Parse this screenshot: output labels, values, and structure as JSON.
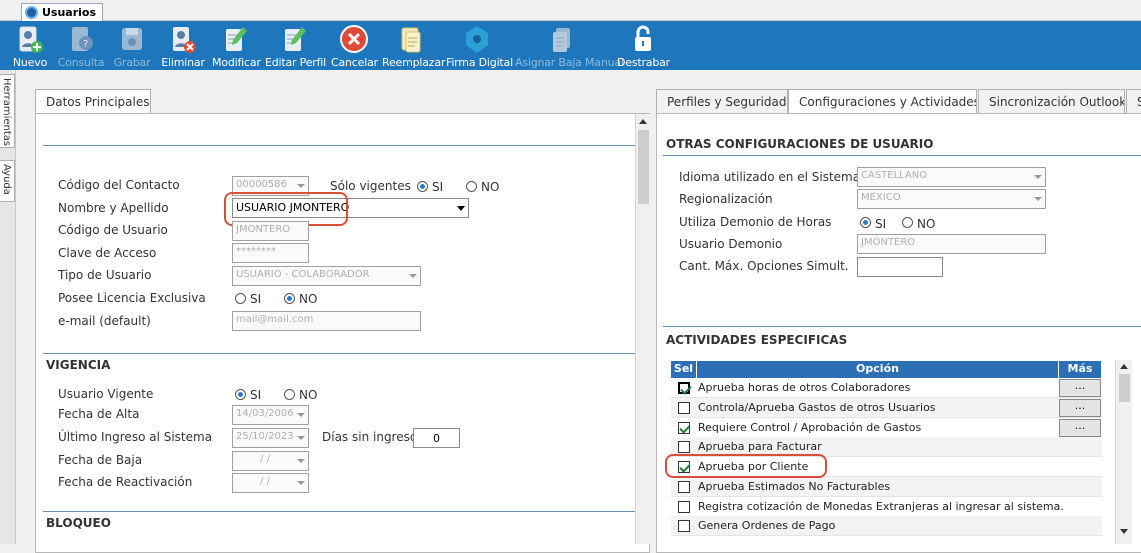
{
  "window_tab": "Usuarios",
  "toolbar": {
    "nuevo": "Nuevo",
    "consulta": "Consulta",
    "grabar": "Grabar",
    "eliminar": "Eliminar",
    "modificar": "Modificar",
    "editar_perfil": "Editar Perfil",
    "cancelar": "Cancelar",
    "reemplazar": "Reemplazar",
    "firma_digital": "Firma Digital",
    "asignar_baja": "Asignar Baja Manual",
    "destrabar": "Destrabar"
  },
  "sidebar": {
    "herramientas": "Herramientas",
    "ayuda": "Ayuda"
  },
  "left": {
    "tab": "Datos Principales",
    "codigo_contacto_label": "Código del Contacto",
    "codigo_contacto_value": "00000586",
    "solo_vigentes_label": "Sólo vigentes",
    "si": "SI",
    "no": "NO",
    "nombre_label": "Nombre y Apellido",
    "nombre_value": "USUARIO JMONTERO",
    "codigo_usuario_label": "Código de Usuario",
    "codigo_usuario_value": "JMONTERO",
    "clave_label": "Clave de Acceso",
    "clave_value": "********",
    "tipo_label": "Tipo de Usuario",
    "tipo_value": "USUARIO - COLABORADOR",
    "licencia_label": "Posee Licencia Exclusiva",
    "email_label": "e-mail (default)",
    "email_value": "mail@mail.com",
    "vigencia_title": "VIGENCIA",
    "usuario_vigente_label": "Usuario Vigente",
    "fecha_alta_label": "Fecha de Alta",
    "fecha_alta_value": "14/03/2006",
    "ultimo_ingreso_label": "Último Ingreso al Sistema",
    "ultimo_ingreso_value": "25/10/2023",
    "dias_sin_ingreso_label": "Días sin ingreso",
    "dias_sin_ingreso_value": "0",
    "fecha_baja_label": "Fecha de Baja",
    "fecha_baja_value": "/ /",
    "fecha_reactivacion_label": "Fecha de Reactivación",
    "fecha_reactivacion_value": "/ /",
    "bloqueo_title": "BLOQUEO"
  },
  "right": {
    "tabs": [
      "Perfiles y Seguridad",
      "Configuraciones y Actividades",
      "Sincronización Outlook",
      "S"
    ],
    "otras_title": "OTRAS CONFIGURACIONES DE USUARIO",
    "idioma_label": "Idioma utilizado en el Sistema",
    "idioma_value": "CASTELLANO",
    "regional_label": "Regionalización",
    "regional_value": "MEXICO",
    "demonio_label": "Utiliza Demonio de Horas",
    "si": "SI",
    "no": "NO",
    "usuario_demonio_label": "Usuario Demonio",
    "usuario_demonio_value": "JMONTERO",
    "cant_max_label": "Cant. Máx. Opciones Simult.",
    "cant_max_value": "",
    "actividades_title": "ACTIVIDADES ESPECIFICAS",
    "grid_headers": {
      "sel": "Sel",
      "opcion": "Opción",
      "mas": "Más"
    },
    "mas_button": "...",
    "rows": [
      {
        "label": "Aprueba horas de otros Colaboradores",
        "checked": true
      },
      {
        "label": "Controla/Aprueba Gastos de otros Usuarios",
        "checked": false
      },
      {
        "label": "Requiere Control / Aprobación de Gastos",
        "checked": true
      },
      {
        "label": "Aprueba para Facturar",
        "checked": false
      },
      {
        "label": "Aprueba por Cliente",
        "checked": true
      },
      {
        "label": "Aprueba Estimados No Facturables",
        "checked": false
      },
      {
        "label": "Registra cotización de Monedas Extranjeras al ingresar al sistema.",
        "checked": false
      },
      {
        "label": "Genera Ordenes de Pago",
        "checked": false
      }
    ]
  },
  "colors": {
    "toolbar": "#1e77bd",
    "grid_header": "#2d6fb5",
    "highlight": "#d9503a"
  }
}
